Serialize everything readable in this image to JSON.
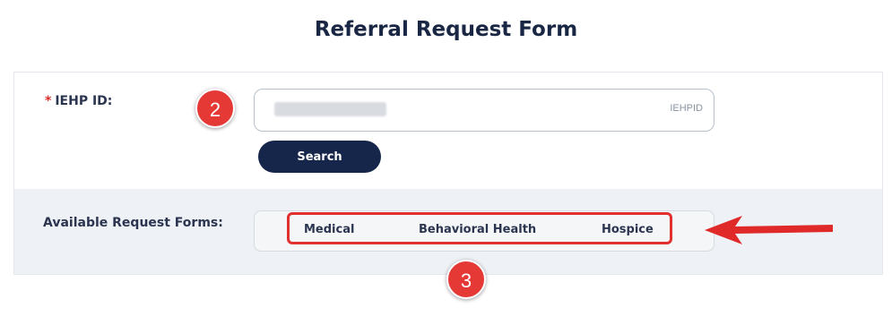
{
  "page": {
    "title": "Referral Request Form"
  },
  "iehp": {
    "required_mark": "*",
    "label": "IEHP ID:",
    "field_hint": "IEHPID",
    "search_label": "Search"
  },
  "forms": {
    "label": "Available Request Forms:",
    "tabs": [
      "Medical",
      "Behavioral Health",
      "Hospice"
    ]
  },
  "annotations": {
    "step_2": "2",
    "step_3": "3"
  },
  "colors": {
    "primary": "#15264a",
    "annotation": "#e53935"
  },
  "icons": {
    "arrow": "arrow-left-icon"
  }
}
